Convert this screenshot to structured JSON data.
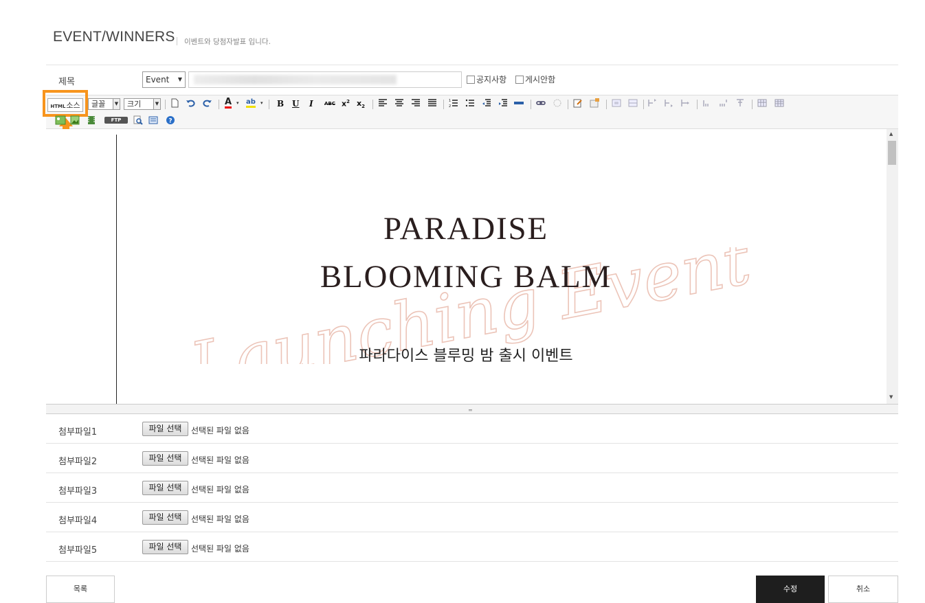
{
  "header": {
    "title": "EVENT/WINNERS",
    "subtitle": "이벤트와 당첨자발표 입니다."
  },
  "form": {
    "subject_label": "제목",
    "category_selected": "Event",
    "notice_label": "공지사항",
    "hide_label": "게시안함"
  },
  "toolbar": {
    "html_source_small": "HTML",
    "html_source_label": "소스",
    "font_label": "글꼴",
    "size_label": "크기",
    "ftp_label": "FTP"
  },
  "editor_content": {
    "title_line1": "PARADISE",
    "title_line2": "BLOOMING BALM",
    "script_text": "Launching Event",
    "subtitle": "파라다이스 블루밍 밤 출시 이벤트"
  },
  "attachments": [
    {
      "label": "첨부파일1",
      "button": "파일 선택",
      "status": "선택된 파일 없음"
    },
    {
      "label": "첨부파일2",
      "button": "파일 선택",
      "status": "선택된 파일 없음"
    },
    {
      "label": "첨부파일3",
      "button": "파일 선택",
      "status": "선택된 파일 없음"
    },
    {
      "label": "첨부파일4",
      "button": "파일 선택",
      "status": "선택된 파일 없음"
    },
    {
      "label": "첨부파일5",
      "button": "파일 선택",
      "status": "선택된 파일 없음"
    }
  ],
  "buttons": {
    "list": "목록",
    "edit": "수정",
    "cancel": "취소"
  },
  "colors": {
    "highlight": "#f7941d",
    "script_pink": "#ecc4b8",
    "primary_button": "#1e1e1e"
  }
}
